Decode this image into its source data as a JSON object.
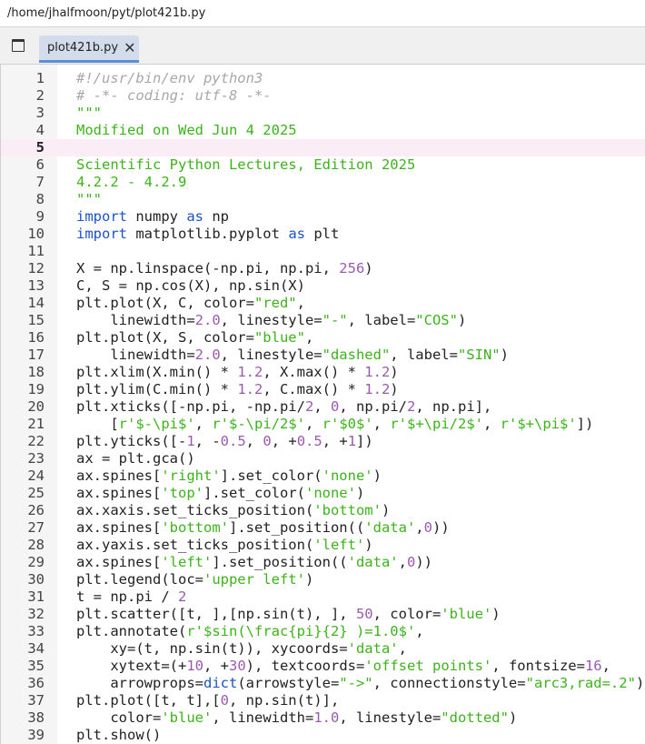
{
  "window": {
    "path": "/home/jhalfmoon/pyt/plot421b.py"
  },
  "tabs": [
    {
      "label": "plot421b.py",
      "active": true
    }
  ],
  "editor": {
    "current_line": 5,
    "lines": [
      {
        "n": "1",
        "segs": [
          {
            "t": "#!/usr/bin/env python3",
            "c": "comment"
          }
        ]
      },
      {
        "n": "2",
        "segs": [
          {
            "t": "# -*- coding: utf-8 -*-",
            "c": "comment"
          }
        ]
      },
      {
        "n": "3",
        "segs": [
          {
            "t": "\"\"\"",
            "c": "str"
          }
        ]
      },
      {
        "n": "4",
        "segs": [
          {
            "t": "Modified on Wed Jun 4 2025",
            "c": "str"
          }
        ]
      },
      {
        "n": "5",
        "segs": []
      },
      {
        "n": "6",
        "segs": [
          {
            "t": "Scientific Python Lectures, Edition 2025",
            "c": "str"
          }
        ]
      },
      {
        "n": "7",
        "segs": [
          {
            "t": "4.2.2 - 4.2.9",
            "c": "str"
          }
        ]
      },
      {
        "n": "8",
        "segs": [
          {
            "t": "\"\"\"",
            "c": "str"
          }
        ]
      },
      {
        "n": "9",
        "segs": [
          {
            "t": "import",
            "c": "kw"
          },
          {
            "t": " numpy ",
            "c": ""
          },
          {
            "t": "as",
            "c": "kw"
          },
          {
            "t": " np",
            "c": ""
          }
        ]
      },
      {
        "n": "10",
        "segs": [
          {
            "t": "import",
            "c": "kw"
          },
          {
            "t": " matplotlib.pyplot ",
            "c": ""
          },
          {
            "t": "as",
            "c": "kw"
          },
          {
            "t": " plt",
            "c": ""
          }
        ]
      },
      {
        "n": "11",
        "segs": []
      },
      {
        "n": "12",
        "segs": [
          {
            "t": "X = np.linspace(-np.pi, np.pi, ",
            "c": ""
          },
          {
            "t": "256",
            "c": "num"
          },
          {
            "t": ")",
            "c": ""
          }
        ]
      },
      {
        "n": "13",
        "segs": [
          {
            "t": "C, S = np.cos(X), np.sin(X)",
            "c": ""
          }
        ]
      },
      {
        "n": "14",
        "segs": [
          {
            "t": "plt.plot(X, C, color=",
            "c": ""
          },
          {
            "t": "\"red\"",
            "c": "str"
          },
          {
            "t": ",",
            "c": ""
          }
        ]
      },
      {
        "n": "15",
        "segs": [
          {
            "t": "    linewidth=",
            "c": ""
          },
          {
            "t": "2.0",
            "c": "num"
          },
          {
            "t": ", linestyle=",
            "c": ""
          },
          {
            "t": "\"-\"",
            "c": "str"
          },
          {
            "t": ", label=",
            "c": ""
          },
          {
            "t": "\"COS\"",
            "c": "str"
          },
          {
            "t": ")",
            "c": ""
          }
        ]
      },
      {
        "n": "16",
        "segs": [
          {
            "t": "plt.plot(X, S, color=",
            "c": ""
          },
          {
            "t": "\"blue\"",
            "c": "str"
          },
          {
            "t": ",",
            "c": ""
          }
        ]
      },
      {
        "n": "17",
        "segs": [
          {
            "t": "    linewidth=",
            "c": ""
          },
          {
            "t": "2.0",
            "c": "num"
          },
          {
            "t": ", linestyle=",
            "c": ""
          },
          {
            "t": "\"dashed\"",
            "c": "str"
          },
          {
            "t": ", label=",
            "c": ""
          },
          {
            "t": "\"SIN\"",
            "c": "str"
          },
          {
            "t": ")",
            "c": ""
          }
        ]
      },
      {
        "n": "18",
        "segs": [
          {
            "t": "plt.xlim(X.min() * ",
            "c": ""
          },
          {
            "t": "1.2",
            "c": "num"
          },
          {
            "t": ", X.max() * ",
            "c": ""
          },
          {
            "t": "1.2",
            "c": "num"
          },
          {
            "t": ")",
            "c": ""
          }
        ]
      },
      {
        "n": "19",
        "segs": [
          {
            "t": "plt.ylim(C.min() * ",
            "c": ""
          },
          {
            "t": "1.2",
            "c": "num"
          },
          {
            "t": ", C.max() * ",
            "c": ""
          },
          {
            "t": "1.2",
            "c": "num"
          },
          {
            "t": ")",
            "c": ""
          }
        ]
      },
      {
        "n": "20",
        "segs": [
          {
            "t": "plt.xticks([-np.pi, -np.pi/",
            "c": ""
          },
          {
            "t": "2",
            "c": "num"
          },
          {
            "t": ", ",
            "c": ""
          },
          {
            "t": "0",
            "c": "num"
          },
          {
            "t": ", np.pi/",
            "c": ""
          },
          {
            "t": "2",
            "c": "num"
          },
          {
            "t": ", np.pi],",
            "c": ""
          }
        ]
      },
      {
        "n": "21",
        "segs": [
          {
            "t": "    [",
            "c": ""
          },
          {
            "t": "r'$-\\pi$'",
            "c": "str"
          },
          {
            "t": ", ",
            "c": ""
          },
          {
            "t": "r'$-\\pi/2$'",
            "c": "str"
          },
          {
            "t": ", ",
            "c": ""
          },
          {
            "t": "r'$0$'",
            "c": "str"
          },
          {
            "t": ", ",
            "c": ""
          },
          {
            "t": "r'$+\\pi/2$'",
            "c": "str"
          },
          {
            "t": ", ",
            "c": ""
          },
          {
            "t": "r'$+\\pi$'",
            "c": "str"
          },
          {
            "t": "])",
            "c": ""
          }
        ]
      },
      {
        "n": "22",
        "segs": [
          {
            "t": "plt.yticks([-",
            "c": ""
          },
          {
            "t": "1",
            "c": "num"
          },
          {
            "t": ", -",
            "c": ""
          },
          {
            "t": "0.5",
            "c": "num"
          },
          {
            "t": ", ",
            "c": ""
          },
          {
            "t": "0",
            "c": "num"
          },
          {
            "t": ", +",
            "c": ""
          },
          {
            "t": "0.5",
            "c": "num"
          },
          {
            "t": ", +",
            "c": ""
          },
          {
            "t": "1",
            "c": "num"
          },
          {
            "t": "])",
            "c": ""
          }
        ]
      },
      {
        "n": "23",
        "segs": [
          {
            "t": "ax = plt.gca()",
            "c": ""
          }
        ]
      },
      {
        "n": "24",
        "segs": [
          {
            "t": "ax.spines[",
            "c": ""
          },
          {
            "t": "'right'",
            "c": "str"
          },
          {
            "t": "].set_color(",
            "c": ""
          },
          {
            "t": "'none'",
            "c": "str"
          },
          {
            "t": ")",
            "c": ""
          }
        ]
      },
      {
        "n": "25",
        "segs": [
          {
            "t": "ax.spines[",
            "c": ""
          },
          {
            "t": "'top'",
            "c": "str"
          },
          {
            "t": "].set_color(",
            "c": ""
          },
          {
            "t": "'none'",
            "c": "str"
          },
          {
            "t": ")",
            "c": ""
          }
        ]
      },
      {
        "n": "26",
        "segs": [
          {
            "t": "ax.xaxis.set_ticks_position(",
            "c": ""
          },
          {
            "t": "'bottom'",
            "c": "str"
          },
          {
            "t": ")",
            "c": ""
          }
        ]
      },
      {
        "n": "27",
        "segs": [
          {
            "t": "ax.spines[",
            "c": ""
          },
          {
            "t": "'bottom'",
            "c": "str"
          },
          {
            "t": "].set_position((",
            "c": ""
          },
          {
            "t": "'data'",
            "c": "str"
          },
          {
            "t": ",",
            "c": ""
          },
          {
            "t": "0",
            "c": "num"
          },
          {
            "t": "))",
            "c": ""
          }
        ]
      },
      {
        "n": "28",
        "segs": [
          {
            "t": "ax.yaxis.set_ticks_position(",
            "c": ""
          },
          {
            "t": "'left'",
            "c": "str"
          },
          {
            "t": ")",
            "c": ""
          }
        ]
      },
      {
        "n": "29",
        "segs": [
          {
            "t": "ax.spines[",
            "c": ""
          },
          {
            "t": "'left'",
            "c": "str"
          },
          {
            "t": "].set_position((",
            "c": ""
          },
          {
            "t": "'data'",
            "c": "str"
          },
          {
            "t": ",",
            "c": ""
          },
          {
            "t": "0",
            "c": "num"
          },
          {
            "t": "))",
            "c": ""
          }
        ]
      },
      {
        "n": "30",
        "segs": [
          {
            "t": "plt.legend(loc=",
            "c": ""
          },
          {
            "t": "'upper left'",
            "c": "str"
          },
          {
            "t": ")",
            "c": ""
          }
        ]
      },
      {
        "n": "31",
        "segs": [
          {
            "t": "t = np.pi / ",
            "c": ""
          },
          {
            "t": "2",
            "c": "num"
          }
        ]
      },
      {
        "n": "32",
        "segs": [
          {
            "t": "plt.scatter([t, ],[np.sin(t), ], ",
            "c": ""
          },
          {
            "t": "50",
            "c": "num"
          },
          {
            "t": ", color=",
            "c": ""
          },
          {
            "t": "'blue'",
            "c": "str"
          },
          {
            "t": ")",
            "c": ""
          }
        ]
      },
      {
        "n": "33",
        "segs": [
          {
            "t": "plt.annotate(",
            "c": ""
          },
          {
            "t": "r'$sin(\\frac{pi}{2} )=1.0$'",
            "c": "str"
          },
          {
            "t": ",",
            "c": ""
          }
        ]
      },
      {
        "n": "34",
        "segs": [
          {
            "t": "    xy=(t, np.sin(t)), xycoords=",
            "c": ""
          },
          {
            "t": "'data'",
            "c": "str"
          },
          {
            "t": ",",
            "c": ""
          }
        ]
      },
      {
        "n": "35",
        "segs": [
          {
            "t": "    xytext=(+",
            "c": ""
          },
          {
            "t": "10",
            "c": "num"
          },
          {
            "t": ", +",
            "c": ""
          },
          {
            "t": "30",
            "c": "num"
          },
          {
            "t": "), textcoords=",
            "c": ""
          },
          {
            "t": "'offset points'",
            "c": "str"
          },
          {
            "t": ", fontsize=",
            "c": ""
          },
          {
            "t": "16",
            "c": "num"
          },
          {
            "t": ",",
            "c": ""
          }
        ]
      },
      {
        "n": "36",
        "segs": [
          {
            "t": "    arrowprops=",
            "c": ""
          },
          {
            "t": "dict",
            "c": "kw"
          },
          {
            "t": "(arrowstyle=",
            "c": ""
          },
          {
            "t": "\"->\"",
            "c": "str"
          },
          {
            "t": ", connectionstyle=",
            "c": ""
          },
          {
            "t": "\"arc3,rad=.2\"",
            "c": "str"
          },
          {
            "t": "))",
            "c": ""
          }
        ]
      },
      {
        "n": "37",
        "segs": [
          {
            "t": "plt.plot([t, t],[",
            "c": ""
          },
          {
            "t": "0",
            "c": "num"
          },
          {
            "t": ", np.sin(t)],",
            "c": ""
          }
        ]
      },
      {
        "n": "38",
        "segs": [
          {
            "t": "    color=",
            "c": ""
          },
          {
            "t": "'blue'",
            "c": "str"
          },
          {
            "t": ", linewidth=",
            "c": ""
          },
          {
            "t": "1.0",
            "c": "num"
          },
          {
            "t": ", linestyle=",
            "c": ""
          },
          {
            "t": "\"dotted\"",
            "c": "str"
          },
          {
            "t": ")",
            "c": ""
          }
        ]
      },
      {
        "n": "39",
        "segs": [
          {
            "t": "plt.show()",
            "c": ""
          }
        ]
      }
    ]
  }
}
